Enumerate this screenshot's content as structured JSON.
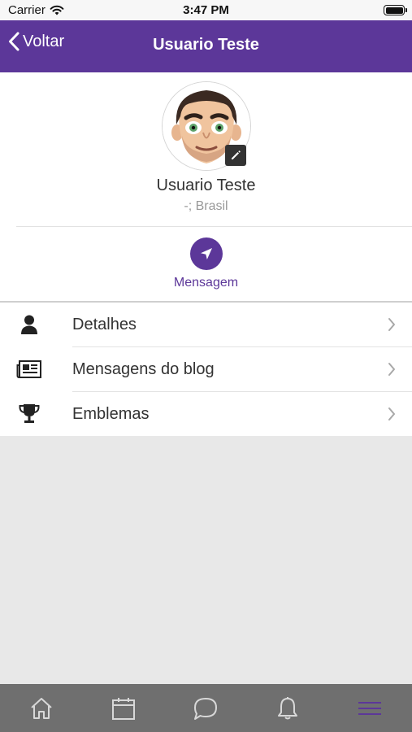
{
  "status_bar": {
    "carrier": "Carrier",
    "time": "3:47 PM",
    "icons": [
      "wifi-icon",
      "battery-icon"
    ]
  },
  "nav_bar": {
    "back_label": "Voltar",
    "title": "Usuario Teste"
  },
  "profile": {
    "name": "Usuario Teste",
    "location": "-; Brasil",
    "avatar": "avatar-icon",
    "edit_icon": "pencil-icon",
    "message_label": "Mensagem"
  },
  "menu": [
    {
      "label": "Detalhes",
      "icon": "person-icon"
    },
    {
      "label": "Mensagens do blog",
      "icon": "newspaper-icon"
    },
    {
      "label": "Emblemas",
      "icon": "trophy-icon"
    }
  ],
  "tab_bar": {
    "tabs": [
      {
        "icon": "home-icon",
        "active": false
      },
      {
        "icon": "calendar-icon",
        "active": false
      },
      {
        "icon": "chat-icon",
        "active": false
      },
      {
        "icon": "bell-icon",
        "active": false
      },
      {
        "icon": "menu-icon",
        "active": true
      }
    ]
  },
  "colors": {
    "brand": "#5c3799",
    "tab_bar": "#6f6f6f",
    "tab_icon": "#d8d8d8",
    "tab_active": "#5c3799",
    "background": "#e8e8e8"
  }
}
